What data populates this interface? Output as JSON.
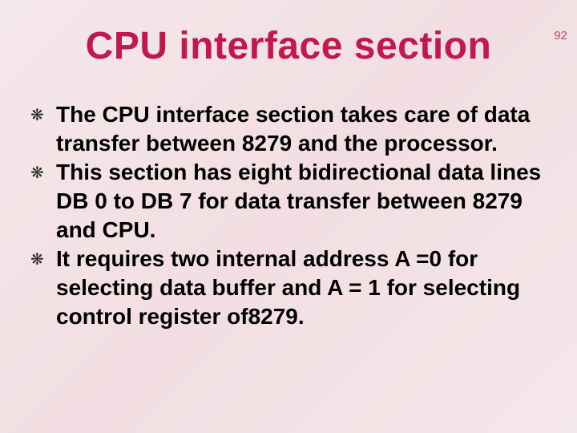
{
  "page_number": "92",
  "title": "CPU interface section",
  "bullets": [
    "The CPU interface section takes care of data transfer between 8279 and the processor.",
    "This section has eight bidirectional data lines DB 0 to DB 7 for data transfer between 8279 and CPU.",
    "It requires two internal address A =0 for selecting data buffer and A = 1 for selecting control register of8279."
  ],
  "bullet_glyph": "❋"
}
